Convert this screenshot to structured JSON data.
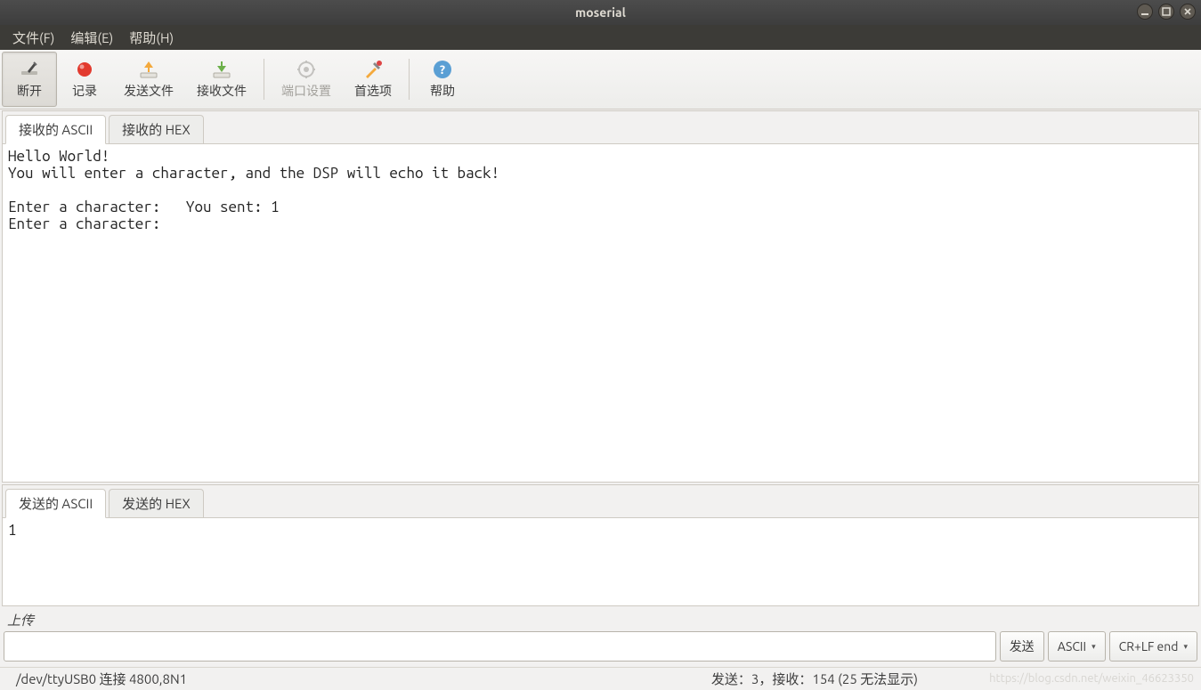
{
  "window": {
    "title": "moserial"
  },
  "menubar": {
    "file": "文件(F)",
    "edit": "编辑(E)",
    "help": "帮助(H)"
  },
  "toolbar": {
    "disconnect": "断开",
    "record": "记录",
    "sendfile": "发送文件",
    "recvfile": "接收文件",
    "portsetup": "端口设置",
    "prefs": "首选项",
    "help": "帮助"
  },
  "recv": {
    "tab_ascii": "接收的 ASCII",
    "tab_hex": "接收的 HEX",
    "content": "Hello World!\nYou will enter a character, and the DSP will echo it back!\n\nEnter a character:   You sent: 1\nEnter a character:"
  },
  "send": {
    "tab_ascii": "发送的 ASCII",
    "tab_hex": "发送的 HEX",
    "content": "1"
  },
  "upload": {
    "label": "上传",
    "input_value": "",
    "send_btn": "发送",
    "encoding": "ASCII",
    "lineend": "CR+LF end"
  },
  "status": {
    "left": "/dev/ttyUSB0 连接 4800,8N1",
    "right": "发送：3，接收：154 (25 无法显示)"
  },
  "watermark": "https://blog.csdn.net/weixin_46623350"
}
